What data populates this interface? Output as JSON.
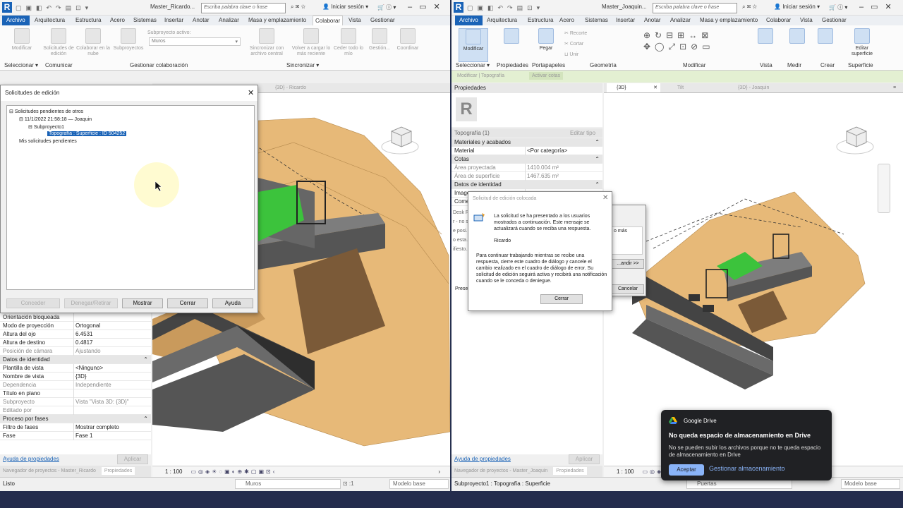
{
  "left": {
    "title": "Master_Ricardo...",
    "search_placeholder": "Escriba palabra clave o frase",
    "signin": "Iniciar sesión",
    "tabs": [
      "Archivo",
      "Arquitectura",
      "Estructura",
      "Acero",
      "Sistemas",
      "Insertar",
      "Anotar",
      "Analizar",
      "Masa y emplazamiento",
      "Colaborar",
      "Vista",
      "Gestionar"
    ],
    "ribbon": {
      "modify": "Modificar",
      "edit_requests": "Solicitudes de edición",
      "collab_cloud": "Colaborar en la nube",
      "subprojects": "Subproyectos",
      "active_label": "Subproyecto activo:",
      "active_value": "Muros",
      "sync": "Sincronizar con archivo central",
      "reload": "Volver a cargar lo más reciente",
      "give_away": "Ceder todo lo mío",
      "manage": "Gestión...",
      "coordinate": "Coordinar"
    },
    "panels": [
      "Seleccionar ▾",
      "Comunicar",
      "Gestionar colaboración",
      "Sincronizar ▾"
    ],
    "view_tab": "{3D} - Ricardo",
    "props": [
      {
        "k": "Orientación bloqueada",
        "v": "",
        "t": "row"
      },
      {
        "k": "Modo de proyección",
        "v": "Ortogonal",
        "t": "row"
      },
      {
        "k": "Altura del ojo",
        "v": "6.4531",
        "t": "row"
      },
      {
        "k": "Altura de destino",
        "v": "0.4817",
        "t": "row"
      },
      {
        "k": "Posición de cámara",
        "v": "Ajustando",
        "t": "dim"
      },
      {
        "k": "Datos de identidad",
        "v": "",
        "t": "sec"
      },
      {
        "k": "Plantilla de vista",
        "v": "<Ninguno>",
        "t": "row"
      },
      {
        "k": "Nombre de vista",
        "v": "{3D}",
        "t": "row"
      },
      {
        "k": "Dependencia",
        "v": "Independiente",
        "t": "dim"
      },
      {
        "k": "Título en plano",
        "v": "",
        "t": "row"
      },
      {
        "k": "Subproyecto",
        "v": "Vista \"Vista 3D: {3D}\"",
        "t": "dim"
      },
      {
        "k": "Editado por",
        "v": "",
        "t": "dim"
      },
      {
        "k": "Proceso por fases",
        "v": "",
        "t": "sec"
      },
      {
        "k": "Filtro de fases",
        "v": "Mostrar completo",
        "t": "row"
      },
      {
        "k": "Fase",
        "v": "Fase 1",
        "t": "row"
      }
    ],
    "help": "Ayuda de propiedades",
    "apply": "Aplicar",
    "browser_tabs": [
      "Navegador de proyectos - Master_Ricardo",
      "Propiedades"
    ],
    "scale": "1 : 100",
    "status": "Listo",
    "workset": "Muros",
    "model": "Modelo base"
  },
  "right": {
    "title": "Master_Joaquin...",
    "search_placeholder": "Escriba palabra clave o frase",
    "signin": "Iniciar sesión",
    "tabs": [
      "Archivo",
      "Arquitectura",
      "Estructura",
      "Acero",
      "Sistemas",
      "Insertar",
      "Anotar",
      "Analizar",
      "Masa y emplazamiento",
      "Colaborar",
      "Vista",
      "Gestionar"
    ],
    "ribbon": {
      "modify": "Modificar",
      "props": "Propiedades",
      "paste": "Pegar",
      "cut": "Recorte",
      "cope": "Cortar",
      "join": "Unir"
    },
    "panels": [
      "Seleccionar ▾",
      "Propiedades",
      "Portapapeles",
      "Geometría",
      "Modificar",
      "Vista",
      "Medir",
      "Crear",
      "Superficie"
    ],
    "edit_surface": "Editar superficie",
    "ctx": [
      "Modificar | Topografía",
      "Activar cotas"
    ],
    "props_title": "Propiedades",
    "type_selector": "Topografía (1)",
    "edit_type": "Editar tipo",
    "props": [
      {
        "k": "Materiales y acabados",
        "v": "",
        "t": "sec"
      },
      {
        "k": "Material",
        "v": "<Por categoría>",
        "t": "row"
      },
      {
        "k": "Cotas",
        "v": "",
        "t": "sec"
      },
      {
        "k": "Área proyectada",
        "v": "1410.004 m²",
        "t": "dim"
      },
      {
        "k": "Área de superficie",
        "v": "1467.635 m²",
        "t": "dim"
      },
      {
        "k": "Datos de identidad",
        "v": "",
        "t": "sec"
      },
      {
        "k": "Imagen",
        "v": "",
        "t": "row"
      },
      {
        "k": "Comentarios",
        "v": "",
        "t": "row"
      }
    ],
    "view_tabs": [
      "{3D}",
      "Tilt",
      "{3D} - Joaquin"
    ],
    "help": "Ayuda de propiedades",
    "apply": "Aplicar",
    "browser_tabs": [
      "Navegador de proyectos - Master_Joaquin",
      "Propiedades"
    ],
    "scale": "1 : 100",
    "status": "Subproyecto1 : Topografía : Superficie",
    "workset": "Puertas",
    "model": "Modelo base",
    "under_dialog": [
      "Desk Re...",
      "r - no s...",
      "e posi...",
      "o esta...",
      "ifiesto...",
      "Prese...",
      "o más",
      "...andir >>",
      "Cancelar"
    ]
  },
  "edit_requests_dialog": {
    "title": "Solicitudes de edición",
    "tree": [
      "Solicitudes pendientes de otros",
      "11/1/2022 21:58:18 — Joaquin",
      "Subproyecto1",
      "Topografía : Superficie : ID 504252",
      "Mis solicitudes pendientes"
    ],
    "buttons": [
      "Conceder",
      "Denegar/Retirar",
      "Mostrar",
      "Cerrar",
      "Ayuda"
    ]
  },
  "placed_dialog": {
    "title": "Solicitud de edición colocada",
    "msg1": "La solicitud se ha presentado a los usuarios mostrados a continuación. Este mensaje se actualizará cuando se reciba una respuesta.",
    "user": "Ricardo",
    "msg2": "Para continuar trabajando mientras se recibe una respuesta, cierre este cuadro de diálogo y cancele el cambio realizado en el cuadro de diálogo de error. Su solicitud de edición seguirá activa y recibirá una notificación cuando se le conceda o deniegue.",
    "close": "Cerrar"
  },
  "drive_toast": {
    "app": "Google Drive",
    "title": "No queda espacio de almacenamiento en Drive",
    "body": "No se pueden subir los archivos porque no te queda espacio de almacenamiento en Drive",
    "accept": "Aceptar",
    "manage": "Gestionar almacenamiento"
  },
  "colors": {
    "file_tab": "#1a63b7",
    "terrain": "#e7b978",
    "roof": "#3cc33c",
    "slab": "#7d7d7d",
    "toast_btn": "#8ab4f8"
  }
}
